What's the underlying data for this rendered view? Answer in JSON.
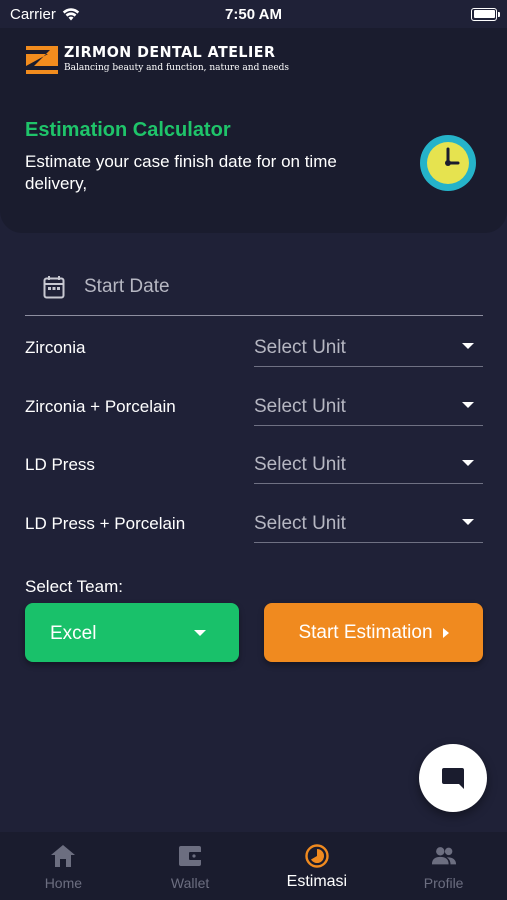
{
  "status_bar": {
    "carrier": "Carrier",
    "time": "7:50 AM"
  },
  "brand": {
    "name": "ZIRMON DENTAL ATELIER",
    "tagline": "Balancing beauty and function, nature and needs",
    "colors": {
      "logo_orange": "#f28c1e",
      "logo_white": "#ffffff"
    }
  },
  "calculator": {
    "title": "Estimation Calculator",
    "description": "Estimate your case finish date for on time delivery,",
    "icon": "clock-icon"
  },
  "start_date": {
    "placeholder": "Start Date",
    "icon": "calendar-icon"
  },
  "products": [
    {
      "label": "Zirconia",
      "unit": "Select Unit"
    },
    {
      "label": "Zirconia + Porcelain",
      "unit": "Select Unit"
    },
    {
      "label": "LD Press",
      "unit": "Select Unit"
    },
    {
      "label": "LD Press + Porcelain",
      "unit": "Select Unit"
    }
  ],
  "team": {
    "label": "Select Team:",
    "selected": "Excel"
  },
  "actions": {
    "start_estimation": "Start Estimation"
  },
  "chat": {
    "icon": "chat-icon"
  },
  "nav": {
    "items": [
      {
        "label": "Home",
        "icon": "home-icon",
        "active": false
      },
      {
        "label": "Wallet",
        "icon": "wallet-icon",
        "active": false
      },
      {
        "label": "Estimasi",
        "icon": "estimasi-icon",
        "active": true
      },
      {
        "label": "Profile",
        "icon": "profile-icon",
        "active": false
      }
    ]
  },
  "colors": {
    "background": "#1f2137",
    "accent_green": "#19c16a",
    "accent_orange": "#f08a1f",
    "nav_inactive": "#6c6e80"
  }
}
